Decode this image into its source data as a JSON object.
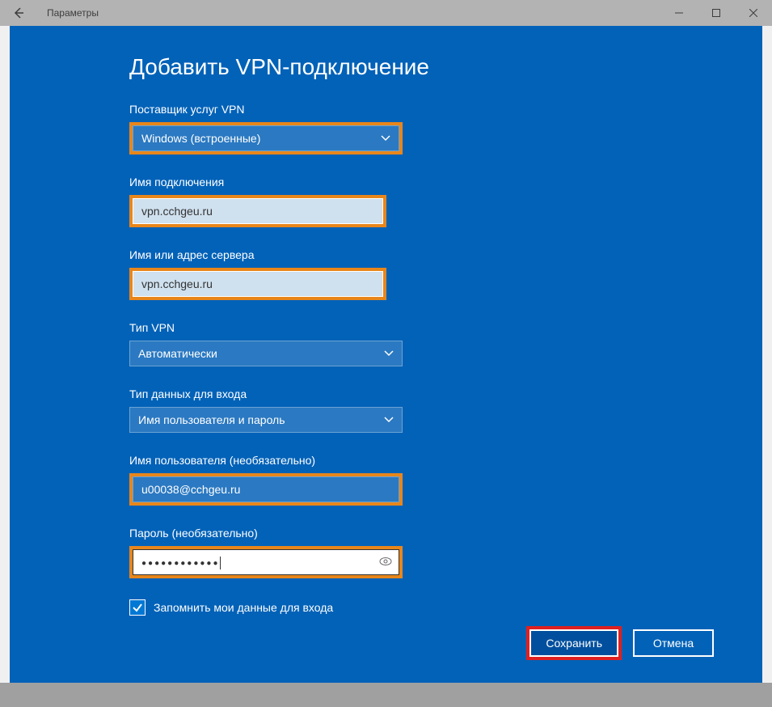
{
  "window": {
    "title": "Параметры"
  },
  "modal": {
    "title": "Добавить VPN-подключение",
    "provider": {
      "label": "Поставщик услуг VPN",
      "value": "Windows (встроенные)"
    },
    "connection_name": {
      "label": "Имя подключения",
      "value": "vpn.cchgeu.ru"
    },
    "server": {
      "label": "Имя или адрес сервера",
      "value": "vpn.cchgeu.ru"
    },
    "vpn_type": {
      "label": "Тип VPN",
      "value": "Автоматически"
    },
    "signin_type": {
      "label": "Тип данных для входа",
      "value": "Имя пользователя и пароль"
    },
    "username": {
      "label": "Имя пользователя (необязательно)",
      "value": "u00038@cchgeu.ru"
    },
    "password": {
      "label": "Пароль (необязательно)",
      "value": "●●●●●●●●●●●●"
    },
    "remember": {
      "label": "Запомнить мои данные для входа",
      "checked": true
    },
    "buttons": {
      "save": "Сохранить",
      "cancel": "Отмена"
    }
  }
}
